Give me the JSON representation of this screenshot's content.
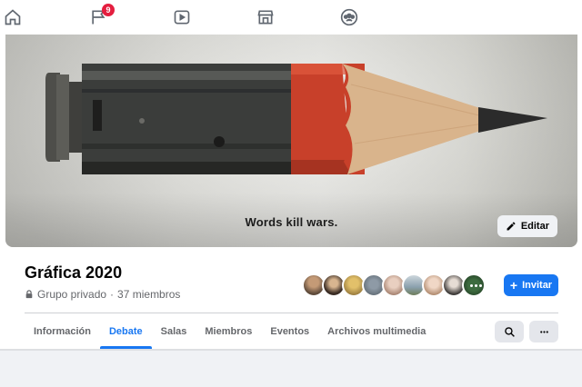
{
  "nav": {
    "items": [
      {
        "name": "home-icon"
      },
      {
        "name": "flag-icon",
        "badge": "9"
      },
      {
        "name": "watch-icon"
      },
      {
        "name": "marketplace-icon"
      },
      {
        "name": "groups-icon"
      }
    ]
  },
  "cover": {
    "slogan": "Words kill wars.",
    "edit_label": "Editar",
    "edit_icon": "pencil-icon"
  },
  "group": {
    "name": "Gráfica 2020",
    "privacy_icon": "lock-icon",
    "privacy": "Grupo privado",
    "separator": "·",
    "members": "37 miembros",
    "invite_label": "Invitar",
    "invite_icon": "plus-icon"
  },
  "tabs": [
    {
      "label": "Información",
      "active": false
    },
    {
      "label": "Debate",
      "active": true
    },
    {
      "label": "Salas",
      "active": false
    },
    {
      "label": "Miembros",
      "active": false
    },
    {
      "label": "Eventos",
      "active": false
    },
    {
      "label": "Archivos multimedia",
      "active": false
    }
  ],
  "actions": {
    "search_icon": "search-icon",
    "more_icon": "more-icon"
  },
  "colors": {
    "accent": "#1877f2",
    "badge": "#e41e3f",
    "text_secondary": "#65676b"
  }
}
